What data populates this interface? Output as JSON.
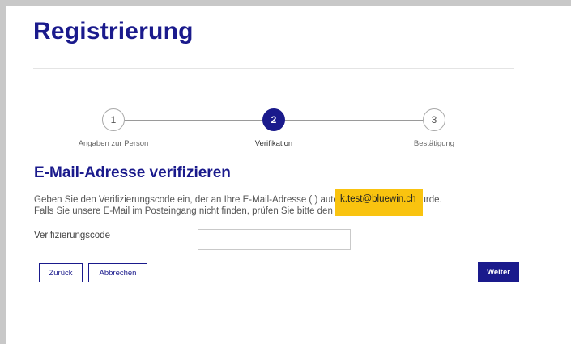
{
  "page": {
    "title": "Registrierung"
  },
  "steps": [
    {
      "number": "1",
      "label": "Angaben zur Person",
      "state": "inactive"
    },
    {
      "number": "2",
      "label": "Verifikation",
      "state": "active"
    },
    {
      "number": "3",
      "label": "Bestätigung",
      "state": "inactive"
    }
  ],
  "verification": {
    "heading": "E-Mail-Adresse verifizieren",
    "line1": "Geben Sie den Verifizierungscode ein, der an Ihre E-Mail-Adresse (                         ) automatisch gesendet wurde.",
    "line2": "Falls Sie unsere E-Mail im Posteingang nicht finden, prüfen Sie bitte den Spam-Ordner.",
    "email_badge": "k.test@bluewin.ch",
    "code_label": "Verifizierungscode",
    "code_value": "",
    "code_placeholder": ""
  },
  "buttons": {
    "back": "Zurück",
    "cancel": "Abbrechen",
    "next": "Weiter"
  },
  "colors": {
    "brand": "#1a1a8c",
    "highlight": "#f9c30f"
  }
}
